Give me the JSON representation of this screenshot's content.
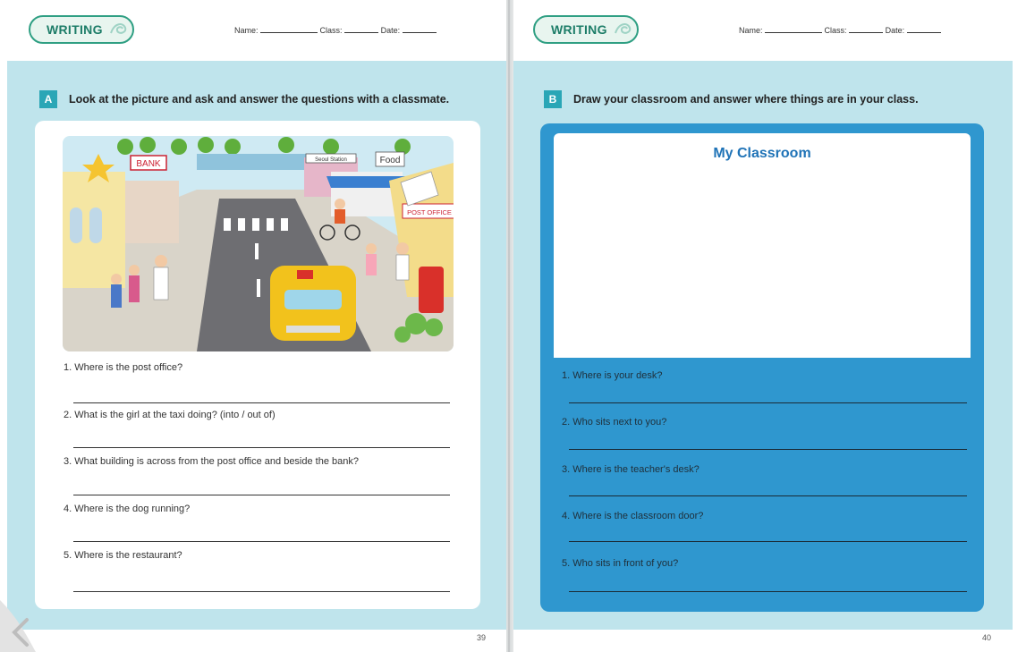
{
  "header": {
    "badge_label": "WRITING",
    "name_label": "Name:",
    "class_label": "Class:",
    "date_label": "Date:"
  },
  "left_page": {
    "section_letter": "A",
    "instruction": "Look at the picture and ask and answer the questions with a classmate.",
    "scene_signs": {
      "bank": "BANK",
      "station": "Seoul Station",
      "food": "Food",
      "post_office": "POST OFFICE"
    },
    "questions": [
      "1. Where is the post office?",
      "2. What is the girl at the taxi doing? (into / out of)",
      "3. What building is across from the post office and beside the bank?",
      "4. Where is the dog running?",
      "5. Where is the restaurant?"
    ],
    "page_number": "39"
  },
  "right_page": {
    "section_letter": "B",
    "instruction": "Draw your classroom and answer where things are in your class.",
    "draw_title": "My Classroom",
    "questions": [
      "1. Where is your desk?",
      "2. Who sits next to you?",
      "3. Where is the teacher's desk?",
      "4. Where is the classroom door?",
      "5. Who sits in front of you?"
    ],
    "page_number": "40"
  },
  "colors": {
    "panel": "#bfe4ec",
    "accent_teal": "#2aa6b6",
    "card_blue": "#2f97cf",
    "title_blue": "#1f73b7",
    "badge_green": "#2f9f83"
  }
}
